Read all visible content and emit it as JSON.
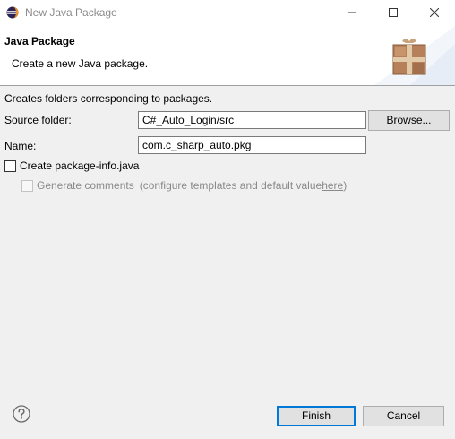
{
  "window": {
    "title": "New Java Package",
    "icons": {
      "app": "eclipse-icon",
      "minimize": "minimize-icon",
      "maximize": "maximize-icon",
      "close": "close-icon"
    }
  },
  "header": {
    "title": "Java Package",
    "subtitle": "Create a new Java package.",
    "icon": "package-icon"
  },
  "body": {
    "description": "Creates folders corresponding to packages.",
    "source_folder": {
      "label": "Source folder:",
      "value": "C#_Auto_Login/src"
    },
    "browse_label": "Browse...",
    "name": {
      "label": "Name:",
      "value": "com.c_sharp_auto.pkg"
    },
    "create_package_info": {
      "label": "Create package-info.java",
      "checked": false
    },
    "generate_comments": {
      "label": "Generate comments",
      "note_prefix": "(configure templates and default value ",
      "link": "here",
      "note_suffix": ")",
      "checked": false,
      "enabled": false
    }
  },
  "footer": {
    "help_icon": "help-icon",
    "finish_label": "Finish",
    "cancel_label": "Cancel"
  },
  "colors": {
    "accent": "#0078d7",
    "button_bg": "#e1e1e1",
    "dialog_bg": "#f0f0f0",
    "disabled_text": "#8a8a8a"
  }
}
